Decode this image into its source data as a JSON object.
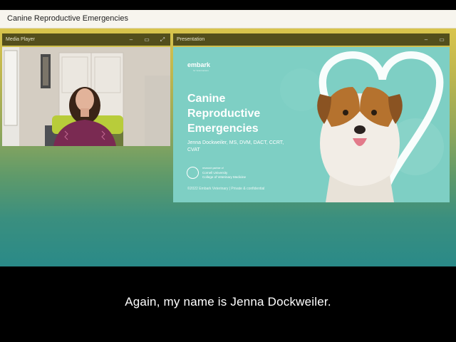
{
  "window": {
    "title": "Canine Reproductive Emergencies"
  },
  "media_player": {
    "title": "Media Player",
    "controls": {
      "minimize": "–",
      "restore": "▭",
      "expand": "⤢"
    }
  },
  "presentation": {
    "title": "Presentation",
    "controls": {
      "minimize": "–",
      "restore": "▭"
    },
    "slide": {
      "brand": "embark",
      "brand_sub": "for Veterinarians",
      "title": "Canine Reproductive Emergencies",
      "author": "Jenna Dockweiler, MS, DVM, DACT, CCRT, CVAT",
      "partner_line1": "research partner of",
      "partner_line2": "Cornell University",
      "partner_line3": "College of Veterinary Medicine",
      "copyright": "©2022 Embark Veterinary | Private & confidential"
    }
  },
  "caption": {
    "text": "Again, my name is Jenna Dockweiler."
  },
  "colors": {
    "titlebar": "#f7f5ee",
    "panel_header": "#534e1c",
    "slide_bg": "#7ecfc4",
    "caption_bg": "#000000"
  }
}
